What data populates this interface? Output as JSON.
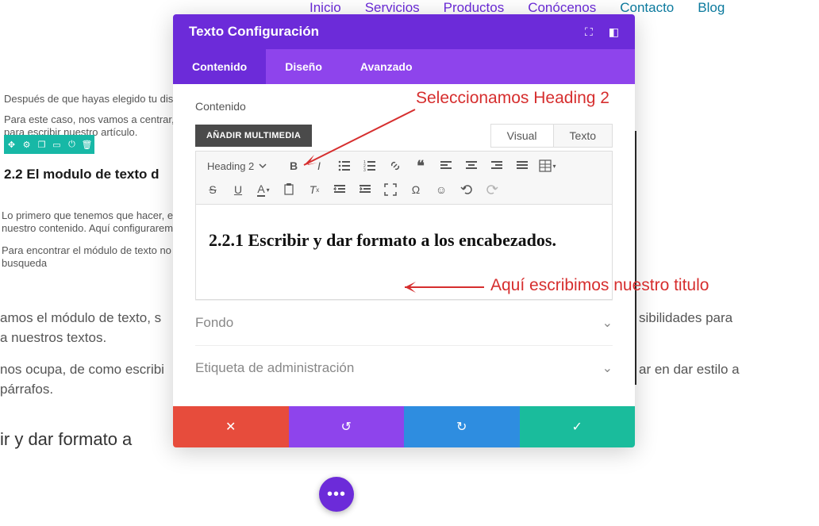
{
  "nav": {
    "items": [
      "Inicio",
      "Servicios",
      "Productos",
      "Conócenos",
      "Contacto",
      "Blog"
    ]
  },
  "bg": {
    "p1": "Después de que hayas elegido tu dise",
    "p2": "Para este caso, nos vamos a centrar,",
    "p3": "para escribir nuestro artículo.",
    "h1": "2.2 El modulo de texto d",
    "p4": "Lo primero que tenemos que hacer, es",
    "p5": "nuestro contenido. Aquí configurarem",
    "p6": "Para encontrar el módulo de texto no",
    "p7": "busqueda",
    "body1a": "amos el módulo de texto, s",
    "body1b": "sibilidades para",
    "body2": "a nuestros textos.",
    "body3a": "nos ocupa, de como escribi",
    "body3b": "ar en dar estilo a",
    "body4": "párrafos.",
    "section": "ir y dar formato a "
  },
  "modal": {
    "title": "Texto Configuración",
    "tabs": [
      "Contenido",
      "Diseño",
      "Avanzado"
    ],
    "content_label": "Contenido",
    "media_button": "AÑADIR MULTIMEDIA",
    "editor_tabs": [
      "Visual",
      "Texto"
    ],
    "format_select": "Heading 2",
    "editor_heading": "2.2.1 Escribir y dar formato a los encabezados.",
    "accordion": [
      "Fondo",
      "Etiqueta de administración"
    ]
  },
  "annotations": {
    "a1": "Seleccionamos Heading 2",
    "a2": "Aquí escribimos nuestro titulo"
  }
}
